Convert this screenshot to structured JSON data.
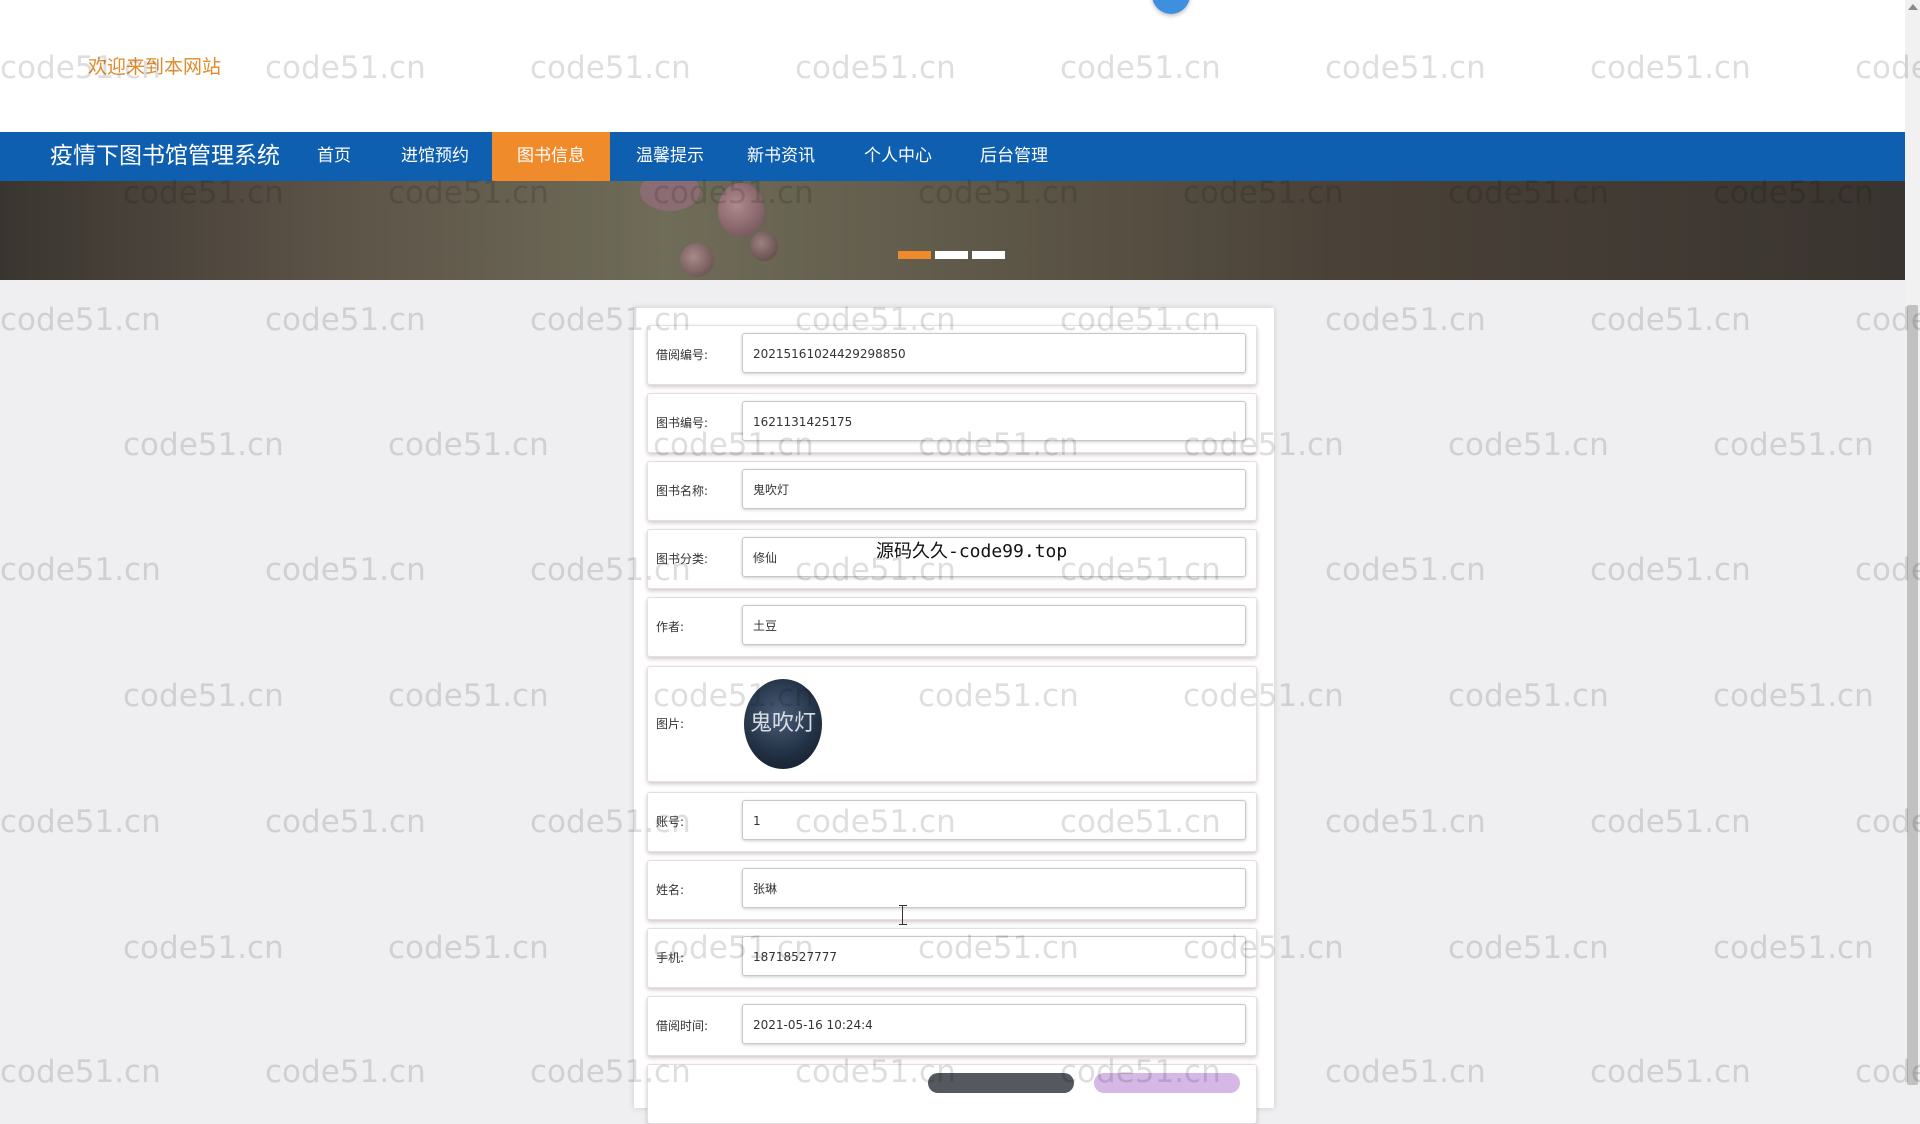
{
  "header": {
    "welcome_text": "欢迎来到本网站"
  },
  "nav": {
    "site_title": "疫情下图书馆管理系统",
    "items": [
      {
        "label": "首页"
      },
      {
        "label": "进馆预约"
      },
      {
        "label": "图书信息",
        "active": true
      },
      {
        "label": "温馨提示"
      },
      {
        "label": "新书资讯"
      },
      {
        "label": "个人中心"
      },
      {
        "label": "后台管理"
      }
    ]
  },
  "banner": {
    "slides": 3,
    "active_slide": 1
  },
  "form": {
    "fields": [
      {
        "label": "借阅编号:",
        "value": "20215161024429298850"
      },
      {
        "label": "图书编号:",
        "value": "1621131425175"
      },
      {
        "label": "图书名称:",
        "value": "鬼吹灯"
      },
      {
        "label": "图书分类:",
        "value": "修仙"
      },
      {
        "label": "作者:",
        "value": "土豆"
      },
      {
        "label": "图片:",
        "image_text": "鬼吹灯"
      },
      {
        "label": "账号:",
        "value": "1"
      },
      {
        "label": "姓名:",
        "value": "张琳"
      },
      {
        "label": "手机:",
        "value": "18718527777"
      },
      {
        "label": "借阅时间:",
        "value": "2021-05-16 10:24:4"
      }
    ]
  },
  "overlay_text": "源码久久-code99.top",
  "watermark_text": "code51.cn",
  "colors": {
    "nav_bg": "#0f5fb0",
    "nav_active": "#f08b2c",
    "welcome_text": "#e08b2c",
    "page_bg": "#efeff1"
  }
}
